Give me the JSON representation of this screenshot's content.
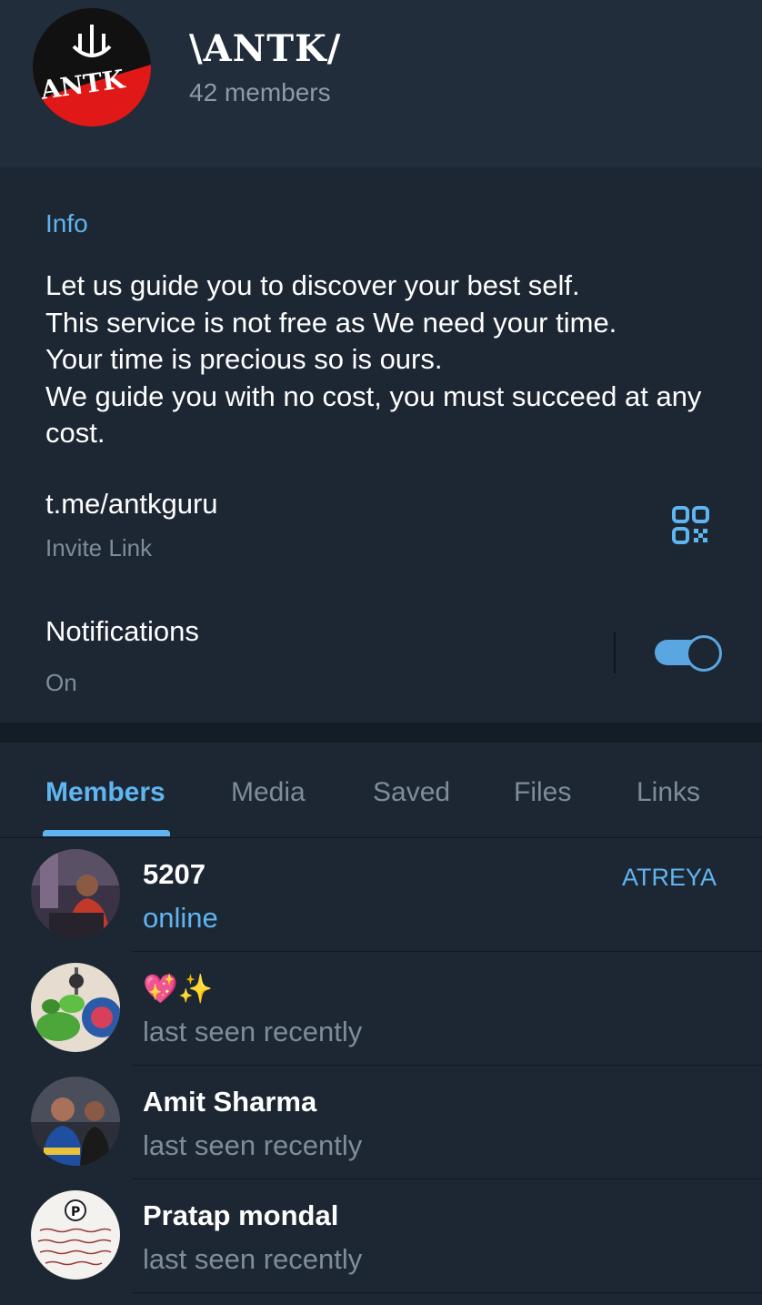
{
  "header": {
    "title": "\\ANTK/",
    "members": "42 members",
    "avatar_text": "ANTK"
  },
  "info": {
    "section_label": "Info",
    "bio": "Let us guide you to discover your best self.\nThis service is not free as We need your time.\nYour time is precious so is ours.\nWe guide you with no cost, you must succeed at any cost.",
    "invite_link": "t.me/antkguru",
    "invite_label": "Invite Link",
    "notifications_label": "Notifications",
    "notifications_state": "On",
    "notifications_on": true
  },
  "tabs": [
    {
      "label": "Members",
      "active": true
    },
    {
      "label": "Media",
      "active": false
    },
    {
      "label": "Saved",
      "active": false
    },
    {
      "label": "Files",
      "active": false
    },
    {
      "label": "Links",
      "active": false
    }
  ],
  "members": [
    {
      "name": "5207",
      "status": "online",
      "role": "ATREYA"
    },
    {
      "name": "💖✨",
      "status": "last seen recently",
      "role": ""
    },
    {
      "name": "Amit Sharma",
      "status": "last seen recently",
      "role": ""
    },
    {
      "name": "Pratap mondal",
      "status": "last seen recently",
      "role": ""
    }
  ],
  "colors": {
    "accent": "#5fb5f0",
    "background": "#1d2733",
    "header": "#212d3b"
  }
}
